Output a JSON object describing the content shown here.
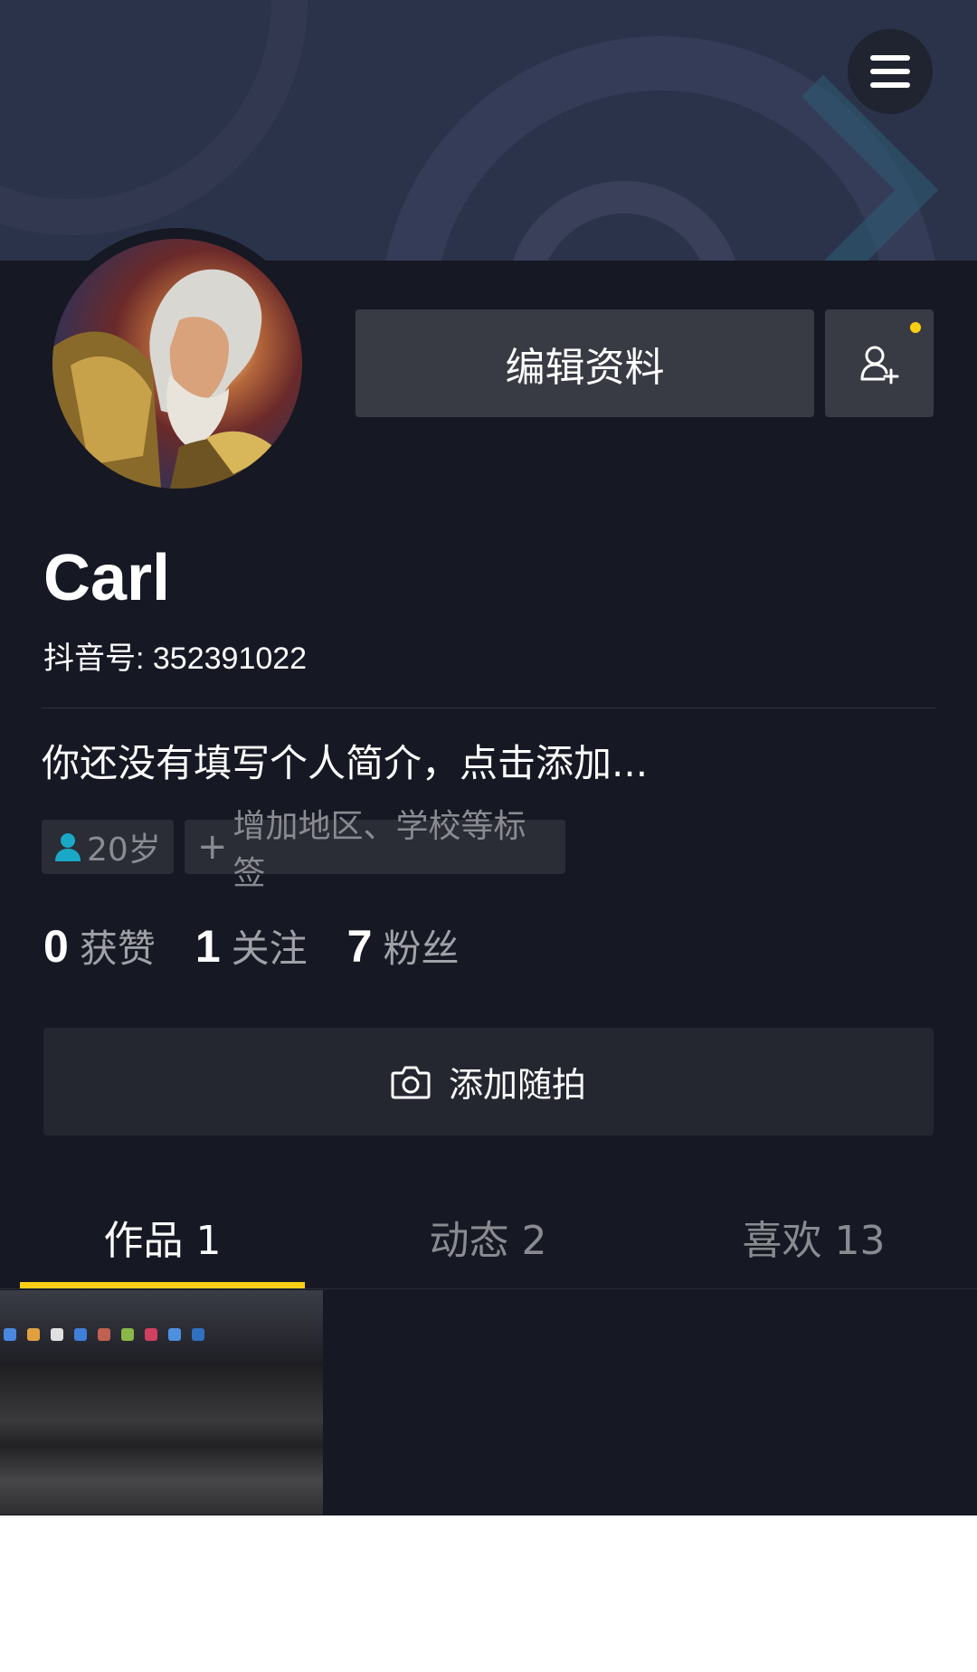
{
  "header": {
    "menu_icon": "hamburger-menu-icon"
  },
  "profile": {
    "edit_label": "编辑资料",
    "add_friend_icon": "add-friend-icon",
    "name": "Carl",
    "douyin_id": "抖音号: 352391022",
    "bio": "你还没有填写个人简介，点击添加...",
    "tags": {
      "age": "20岁",
      "add": "增加地区、学校等标签"
    }
  },
  "stats": [
    {
      "num": "0",
      "label": "获赞"
    },
    {
      "num": "1",
      "label": "关注"
    },
    {
      "num": "7",
      "label": "粉丝"
    }
  ],
  "shoot": {
    "label": "添加随拍",
    "icon": "camera-icon"
  },
  "tabs": [
    {
      "label": "作品 1",
      "active": true
    },
    {
      "label": "动态 2",
      "active": false
    },
    {
      "label": "喜欢 13",
      "active": false
    }
  ],
  "colors": {
    "background": "#161823",
    "accent": "#face15",
    "button": "#393b44"
  }
}
